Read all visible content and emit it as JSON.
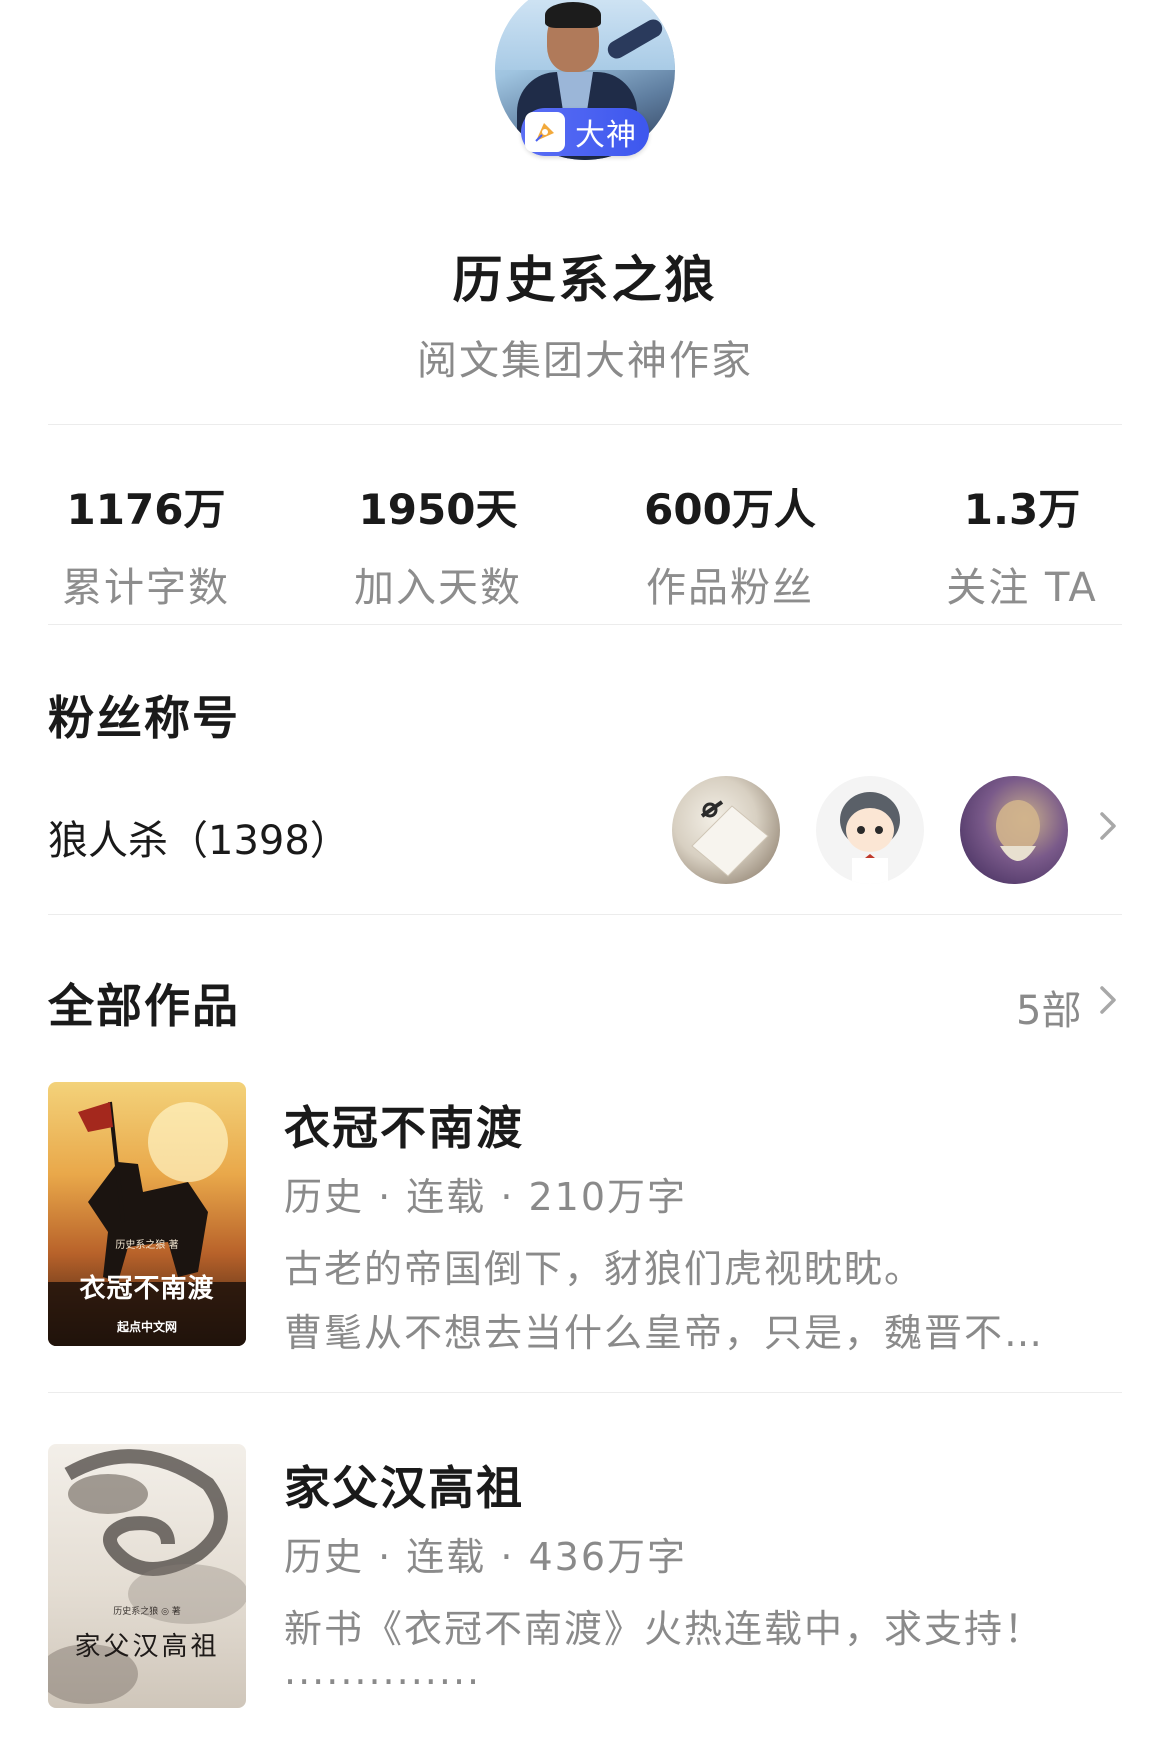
{
  "profile": {
    "name": "历史系之狼",
    "subtitle": "阅文集团大神作家",
    "badge_label": "大神"
  },
  "stats": [
    {
      "value": "1176万",
      "label": "累计字数"
    },
    {
      "value": "1950天",
      "label": "加入天数"
    },
    {
      "value": "600万人",
      "label": "作品粉丝"
    },
    {
      "value": "1.3万",
      "label": "关注 TA"
    }
  ],
  "fan_title": {
    "heading": "粉丝称号",
    "name": "狼人杀（1398）"
  },
  "works": {
    "heading": "全部作品",
    "count": "5部",
    "books": [
      {
        "title": "衣冠不南渡",
        "meta": "历史 · 连载 · 210万字",
        "desc1": "古老的帝国倒下，豺狼们虎视眈眈。",
        "desc2": "曹髦从不想去当什么皇帝，只是，魏晋不…",
        "cover_title": "衣冠不南渡",
        "cover_author": "历史系之狼 著",
        "cover_publisher": "起点中文网"
      },
      {
        "title": "家父汉高祖",
        "meta": "历史 · 连载 · 436万字",
        "desc1": "新书《衣冠不南渡》火热连载中，求支持！",
        "desc2": "··············",
        "cover_title": "家父汉高祖",
        "cover_author": "历史系之狼 ◎ 著"
      }
    ]
  },
  "colors": {
    "badge_blue": "#4a62f2",
    "text_primary": "#1a1a1a",
    "text_secondary": "#8a8a8a",
    "divider": "#ececec"
  },
  "icons": [
    "pen-nib-icon",
    "chevron-right-icon"
  ]
}
